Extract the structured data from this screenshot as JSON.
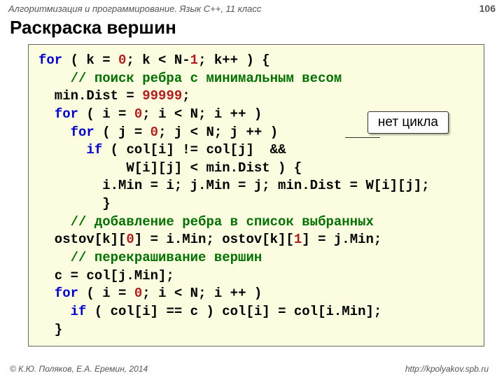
{
  "header": {
    "course": "Алгоритмизация и программирование. Язык C++, 11 класс",
    "page_number": "106"
  },
  "title": "Раскраска вершин",
  "code": {
    "l1a": "for",
    "l1b": " ( k = ",
    "l1c": "0",
    "l1d": "; k < N-",
    "l1e": "1",
    "l1f": "; k++ ) {",
    "l2": "    // поиск ребра с минимальным весом",
    "l3a": "  min.Dist = ",
    "l3b": "99999",
    "l3c": ";",
    "l4a": "  ",
    "l4b": "for",
    "l4c": " ( i = ",
    "l4d": "0",
    "l4e": "; i < N; i ++ )",
    "l5a": "    ",
    "l5b": "for",
    "l5c": " ( j = ",
    "l5d": "0",
    "l5e": "; j < N; j ++ )",
    "l6a": "      ",
    "l6b": "if",
    "l6c": " ( col[i] != col[j]  &&",
    "l7": "           W[i][j] < min.Dist ) {",
    "l8": "        i.Min = i; j.Min = j; min.Dist = W[i][j];",
    "l9": "        }",
    "l10": "    // добавление ребра в список выбранных",
    "l11a": "  ostov[k][",
    "l11b": "0",
    "l11c": "] = i.Min; ostov[k][",
    "l11d": "1",
    "l11e": "] = j.Min;",
    "l12": "    // перекрашивание вершин",
    "l13": "  c = col[j.Min];",
    "l14a": "  ",
    "l14b": "for",
    "l14c": " ( i = ",
    "l14d": "0",
    "l14e": "; i < N; i ++ )",
    "l15a": "    ",
    "l15b": "if",
    "l15c": " ( col[i] == c ) col[i] = col[i.Min];",
    "l16": "  }"
  },
  "callout": "нет цикла",
  "footer": {
    "copyright": "© К.Ю. Поляков, Е.А. Еремин, 2014",
    "url": "http://kpolyakov.spb.ru"
  }
}
